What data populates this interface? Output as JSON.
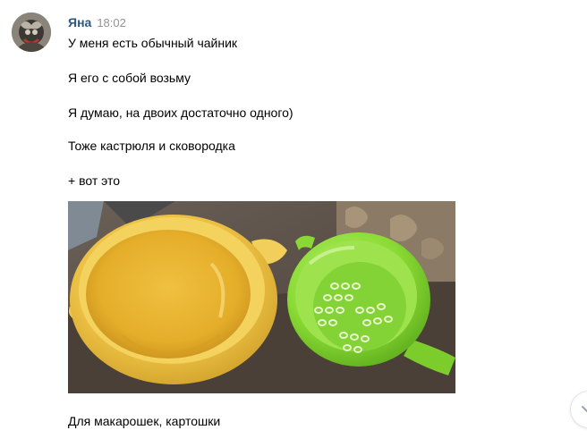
{
  "message": {
    "author": "Яна",
    "time": "18:02",
    "avatar_icon": "user-avatar",
    "lines": [
      "У меня есть обычный чайник",
      "Я его с собой возьму",
      "Я думаю, на двоих достаточно одного)",
      "Тоже кастрюля и сковородка",
      "+ вот это"
    ],
    "photo_icon": "photo-yellow-bowl-and-green-colander",
    "caption": "Для макарошек, картошки"
  },
  "scroll_button": {
    "icon": "chevron-down-icon"
  },
  "colors": {
    "author": "#2a5885",
    "time": "#939393",
    "text": "#000000",
    "background": "#ffffff"
  }
}
